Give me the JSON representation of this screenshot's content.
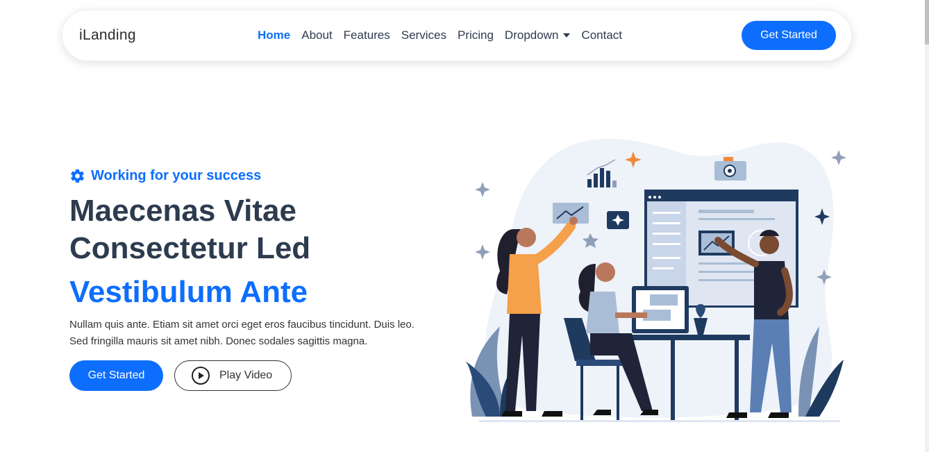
{
  "header": {
    "logo": "iLanding",
    "nav": [
      {
        "label": "Home"
      },
      {
        "label": "About"
      },
      {
        "label": "Features"
      },
      {
        "label": "Services"
      },
      {
        "label": "Pricing"
      },
      {
        "label": "Dropdown"
      },
      {
        "label": "Contact"
      }
    ],
    "cta": "Get Started"
  },
  "hero": {
    "badge": "Working for your success",
    "title_line1": "Maecenas Vitae",
    "title_line2": "Consectetur Led",
    "accent": "Vestibulum Ante",
    "desc_line1": "Nullam quis ante. Etiam sit amet orci eget eros faucibus tincidunt. Duis leo.",
    "desc_line2": "Sed fringilla mauris sit amet nibh. Donec sodales sagittis magna.",
    "primary_button": "Get Started",
    "video_button": "Play Video"
  },
  "colors": {
    "accent": "#0d6efd",
    "heading": "#2d3b4e",
    "illustration_navy": "#1f3a5f",
    "illustration_orange": "#f5a04a"
  }
}
